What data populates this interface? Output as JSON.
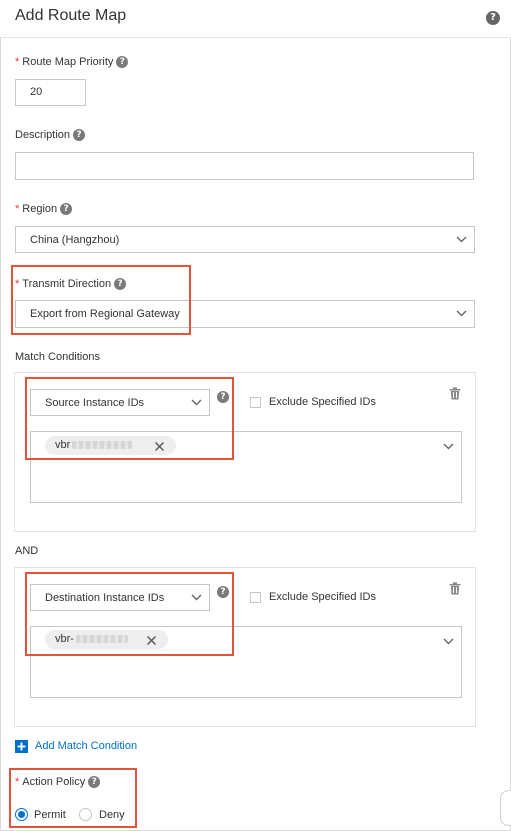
{
  "header": {
    "title": "Add Route Map",
    "help_icon": "question-circle-icon"
  },
  "fields": {
    "priority": {
      "label": "Route Map Priority",
      "value": "20"
    },
    "description": {
      "label": "Description",
      "value": ""
    },
    "region": {
      "label": "Region",
      "value": "China (Hangzhou)"
    },
    "transmit_direction": {
      "label": "Transmit Direction",
      "value": "Export from Regional Gateway"
    }
  },
  "match": {
    "label": "Match Conditions",
    "and_label": "AND",
    "conditions": [
      {
        "type": "Source Instance IDs",
        "exclude_label": "Exclude Specified IDs",
        "tags": [
          "vbr"
        ]
      },
      {
        "type": "Destination Instance IDs",
        "exclude_label": "Exclude Specified IDs",
        "tags": [
          "vbr-"
        ]
      }
    ],
    "add_label": "Add Match Condition"
  },
  "action_policy": {
    "label": "Action Policy",
    "options": [
      {
        "label": "Permit",
        "selected": true
      },
      {
        "label": "Deny",
        "selected": false
      }
    ]
  },
  "colors": {
    "accent": "#0070cc",
    "required": "#e4393c",
    "highlight": "#e2553a"
  }
}
